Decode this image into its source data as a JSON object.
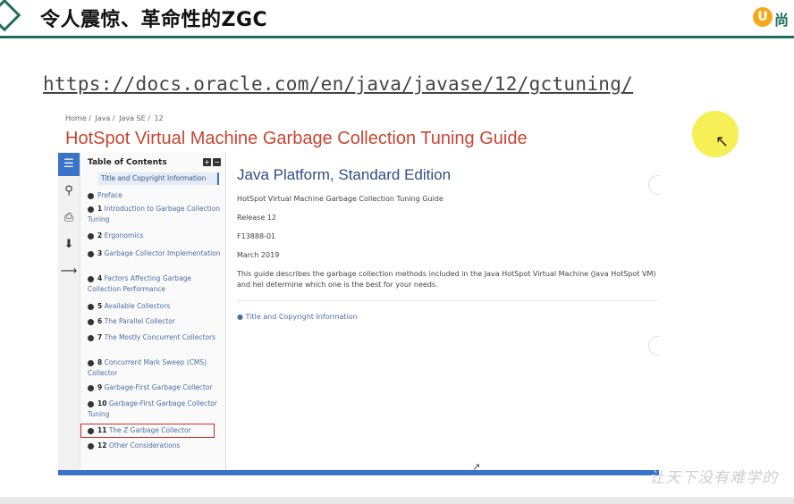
{
  "slide": {
    "title": "令人震惊、革命性的ZGC",
    "brand_mark": "U",
    "brand_text": "尚",
    "url": "https://docs.oracle.com/en/java/javase/12/gctuning/",
    "watermark": "让天下没有难学的"
  },
  "docs": {
    "breadcrumb": [
      "Home /",
      "Java /",
      "Java SE /",
      "12"
    ],
    "page_title": "HotSpot Virtual Machine Garbage Collection Tuning Guide",
    "rail_icons": [
      "list-icon",
      "search-icon",
      "print-icon",
      "download-icon",
      "share-icon"
    ],
    "toc": {
      "heading": "Table of Contents",
      "expand": "+",
      "collapse": "−",
      "first_item": "Title and Copyright Information",
      "items": [
        {
          "num": "",
          "label": "Preface"
        },
        {
          "num": "1",
          "label": "Introduction to Garbage Collection Tuning"
        },
        {
          "num": "2",
          "label": "Ergonomics"
        },
        {
          "num": "3",
          "label": "Garbage Collector Implementation"
        },
        {
          "num": "4",
          "label": "Factors Affecting Garbage Collection Performance"
        },
        {
          "num": "5",
          "label": "Available Collectors"
        },
        {
          "num": "6",
          "label": "The Parallel Collector"
        },
        {
          "num": "7",
          "label": "The Mostly Concurrent Collectors"
        },
        {
          "num": "8",
          "label": "Concurrent Mark Sweep (CMS) Collector"
        },
        {
          "num": "9",
          "label": "Garbage-First Garbage Collector"
        },
        {
          "num": "10",
          "label": "Garbage-First Garbage Collector Tuning"
        },
        {
          "num": "11",
          "label": "The Z Garbage Collector"
        },
        {
          "num": "12",
          "label": "Other Considerations"
        }
      ]
    },
    "main": {
      "heading": "Java Platform, Standard Edition",
      "subtitle": "HotSpot Virtual Machine Garbage Collection Tuning Guide",
      "release": "Release 12",
      "doc_id": "F13888-01",
      "date": "March 2019",
      "description": "This guide describes the garbage collection methods included in the Java HotSpot Virtual Machine (Java HotSpot VM) and hel determine which one is the best for your needs.",
      "link": "Title and Copyright Information"
    }
  },
  "colors": {
    "accent_green": "#1f6f5c",
    "oracle_red": "#c74634",
    "link_blue": "#4a6fa5",
    "highlight_red": "#d32b2b",
    "cursor_yellow": "#f7ef56"
  }
}
